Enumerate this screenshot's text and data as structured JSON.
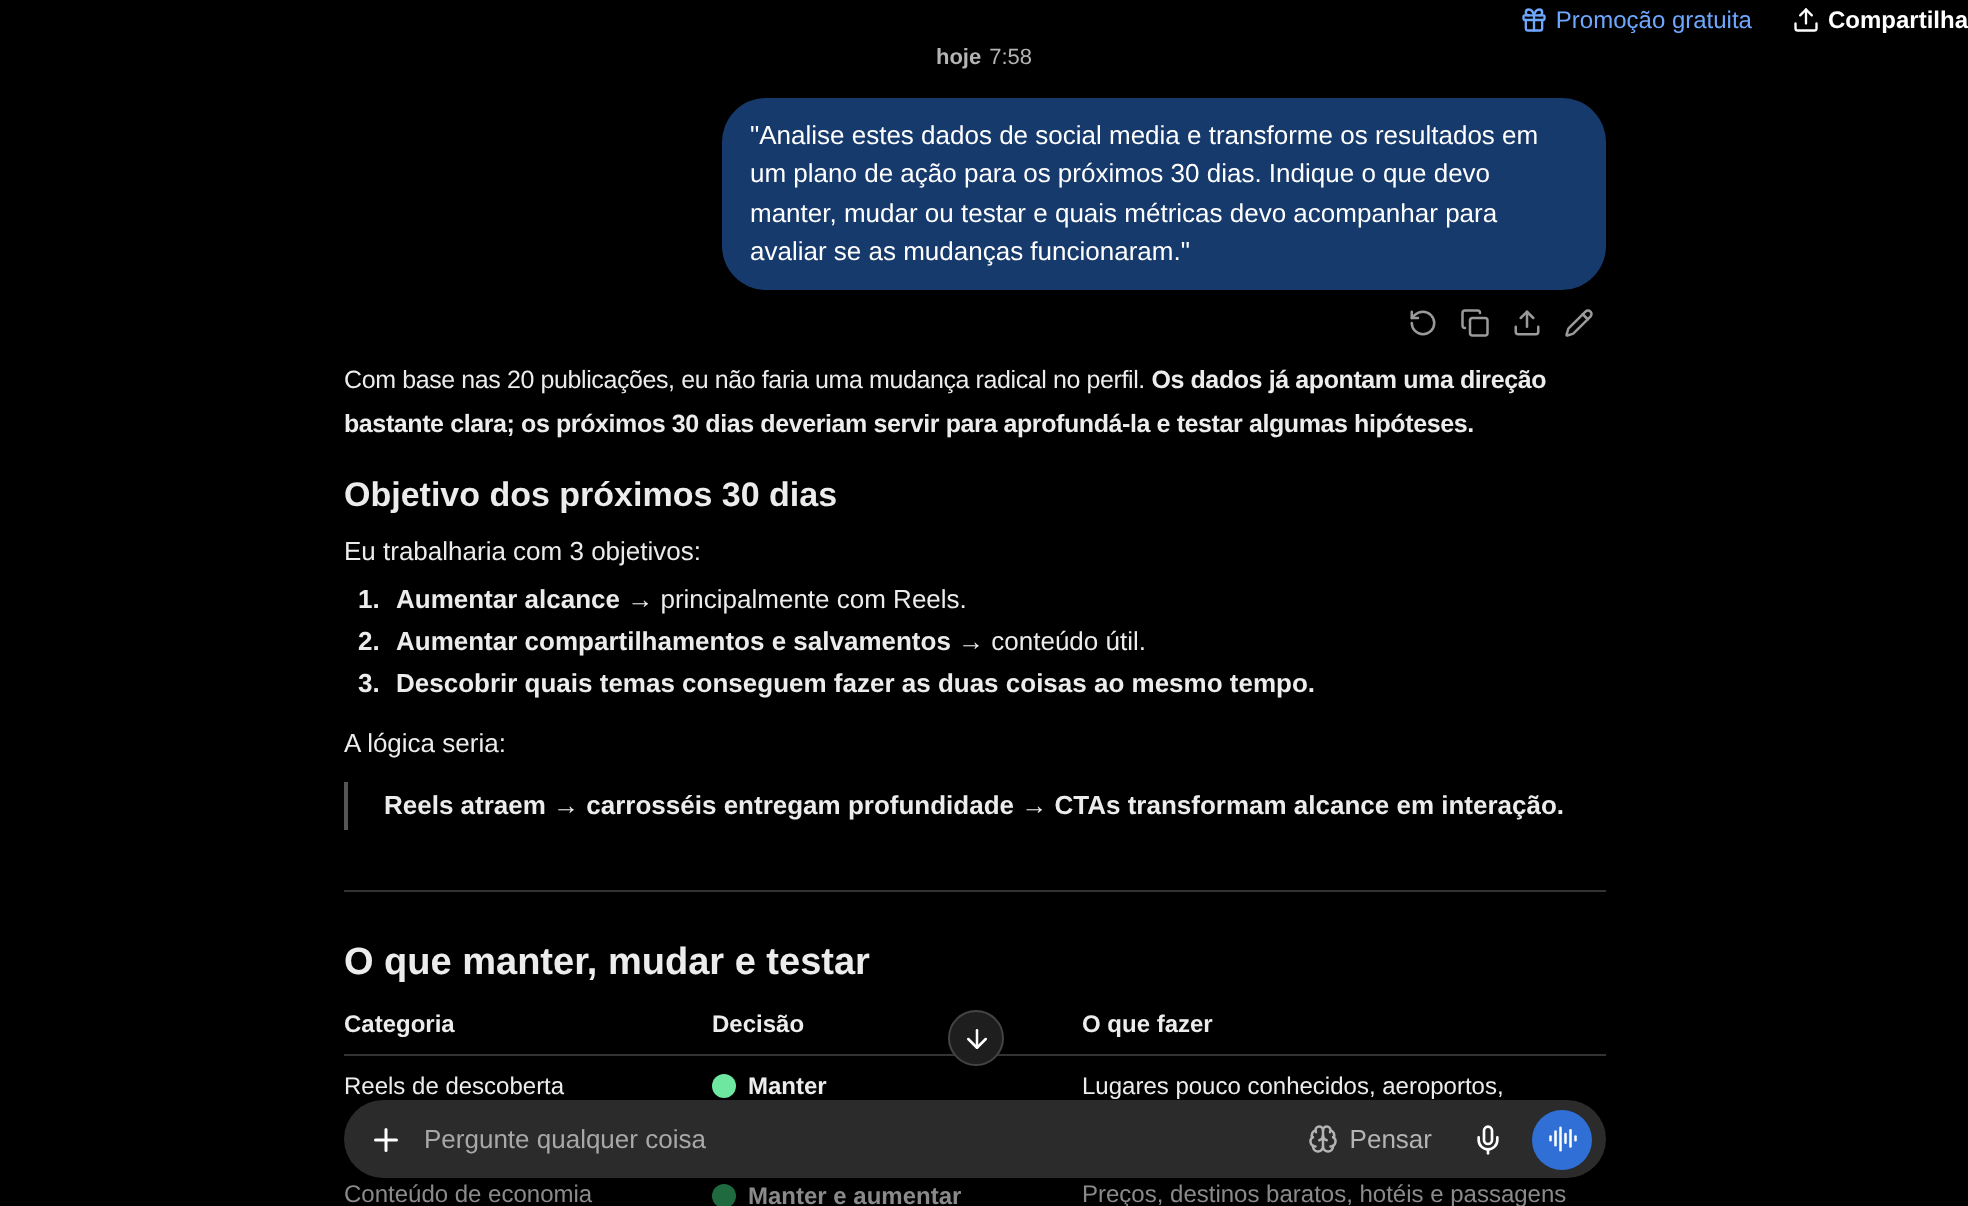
{
  "top_bar": {
    "promo": "Promoção gratuita",
    "share": "Compartilha"
  },
  "timestamp": {
    "day": "hoje",
    "time": "7:58"
  },
  "user_message": "\"Analise estes dados de social media e transforme os resultados em um plano de ação para os próximos 30 dias. Indique o que devo manter, mudar ou testar e quais métricas devo acompanhar para avaliar se as mudanças funcionaram.\"",
  "intro": "Com base nas 20 publicações, eu não faria uma mudança radical no perfil. **Os dados já apontam uma direção bastante clara; os próximos 30 dias deveriam servir para aprofundá-la e testar algumas hipóteses.**",
  "heading_1": "Objetivo dos próximos 30 dias",
  "lead": "Eu trabalharia com 3 objetivos:",
  "objectives": [
    {
      "number": "1.",
      "text": "**Aumentar alcance** → principalmente com Reels."
    },
    {
      "number": "2.",
      "text": "**Aumentar compartilhamentos e salvamentos** → conteúdo útil."
    },
    {
      "number": "3.",
      "text": "**Descobrir quais temas conseguem fazer as duas coisas ao mesmo tempo.**"
    }
  ],
  "logic_lead": "A lógica seria:",
  "quote": "Reels atraem → carrosséis entregam profundidade → CTAs transformam alcance em interação.",
  "heading_2": "O que manter, mudar e testar",
  "table": {
    "columns": [
      "Categoria",
      "Decisão",
      "O que fazer"
    ],
    "rows": [
      {
        "category": "Reels de descoberta",
        "decision": "Manter",
        "color": "#6ee7a0",
        "action": "Lugares pouco conhecidos, aeroportos,"
      },
      {
        "category": "Conteúdo de economia",
        "decision": "Manter e aumentar",
        "color": "#1f6b3f",
        "action": "Preços, destinos baratos, hotéis e passagens"
      }
    ]
  },
  "composer": {
    "placeholder": "Pergunte qualquer coisa",
    "think": "Pensar"
  }
}
